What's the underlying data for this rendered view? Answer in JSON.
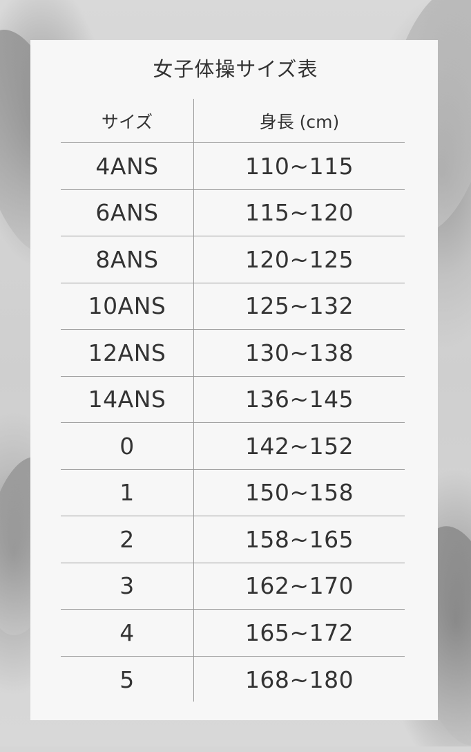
{
  "title": "女子体操サイズ表",
  "table": {
    "headers": {
      "size": "サイズ",
      "height": "身長 (cm)"
    },
    "rows": [
      {
        "size": "4ANS",
        "height": "110~115"
      },
      {
        "size": "6ANS",
        "height": "115~120"
      },
      {
        "size": "8ANS",
        "height": "120~125"
      },
      {
        "size": "10ANS",
        "height": "125~132"
      },
      {
        "size": "12ANS",
        "height": "130~138"
      },
      {
        "size": "14ANS",
        "height": "136~145"
      },
      {
        "size": "0",
        "height": "142~152"
      },
      {
        "size": "1",
        "height": "150~158"
      },
      {
        "size": "2",
        "height": "158~165"
      },
      {
        "size": "3",
        "height": "162~170"
      },
      {
        "size": "4",
        "height": "165~172"
      },
      {
        "size": "5",
        "height": "168~180"
      }
    ]
  },
  "colors": {
    "card_background": "#f7f7f7",
    "text": "#333333",
    "rule": "#9a9a9a"
  }
}
